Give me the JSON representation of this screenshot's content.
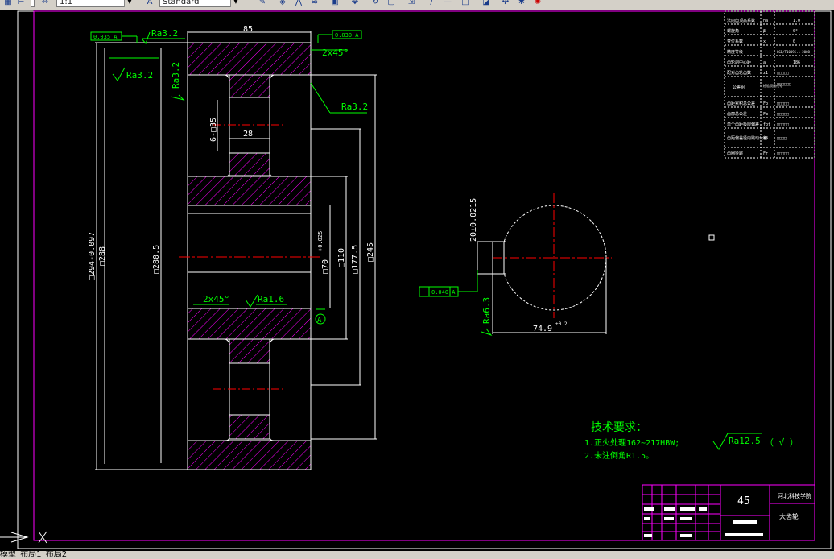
{
  "toolbar": {
    "scale_value": "1:1",
    "dimstyle_value": "Standard"
  },
  "tabs": {
    "model": "模型",
    "layout1": "布局1",
    "layout2": "布局2"
  },
  "gear_front": {
    "dim_85": "85",
    "chamfer_top": "2x45°",
    "chamfer_bottom": "2x45°",
    "ra_left_top": "Ra3.2",
    "ra_left_mid": "Ra3.2",
    "ra_vertical": "Ra3.2",
    "ra_right": "Ra3.2",
    "ra_bottom": "Ra1.6",
    "tol_runout_left": "0.035 A",
    "tol_runout_right": "0.030 A",
    "dim_holes": "6-□35",
    "dim_28": "28",
    "dim_od": "□294-0.097",
    "dim_288": "□288",
    "dim_280": "□280.5",
    "dim_bore": "□70",
    "dim_bore_tol": "+0.025",
    "dim_110": "□110",
    "dim_177": "□177.5",
    "dim_245": "□245",
    "datum": "A"
  },
  "gear_side": {
    "dim_keyway": "20±0.0215",
    "dim_74": "74.9",
    "dim_74_tol": "+0.2",
    "ra": "Ra6.3",
    "tol_sym": "0.040 A"
  },
  "param_table": [
    {
      "name": "法向齿顶高系数",
      "symbol": "ha",
      "value": "1.0"
    },
    {
      "name": "螺旋角",
      "symbol": "β",
      "value": "0°"
    },
    {
      "name": "变位系数",
      "symbol": "x",
      "value": "0"
    },
    {
      "name": "精度等级",
      "symbol": "",
      "value": "8GB/T10095.1-2008"
    },
    {
      "name": "齿轮副中心距",
      "symbol": "a",
      "value": "186"
    },
    {
      "name": "配对齿轮齿数",
      "symbol": "z1",
      "value": "□□□□□"
    },
    {
      "name": "公差组",
      "symbol": "",
      "value": "检验项目代号"
    },
    {
      "name": "齿距累积总公差",
      "symbol": "Fp",
      "value": "□□□□□"
    },
    {
      "name": "齿廓总公差",
      "symbol": "Fα",
      "value": "□□□□□"
    },
    {
      "name": "单个齿距极限偏差",
      "symbol": "fpt",
      "value": "□□□□□"
    },
    {
      "name": "齿距偏差径向跳动公差",
      "symbol": "Fβ",
      "value": "□□□□"
    },
    {
      "name": "齿圈径跳",
      "symbol": "Fr",
      "value": "□□□□□"
    }
  ],
  "tech_req": {
    "title": "技术要求：",
    "line1": "1.正火处理162~217HBW;",
    "line2": "2.未注倒角R1.5。",
    "ra_other": "Ra12.5",
    "ra_paren": "（  √  ）"
  },
  "title_block": {
    "material": "45",
    "school": "河北科技学院",
    "part_name": "大齿轮"
  },
  "colors": {
    "green": "#00ff00",
    "magenta": "#ff00ff",
    "white": "#ffffff",
    "red": "#ff0000",
    "background": "#000000"
  }
}
